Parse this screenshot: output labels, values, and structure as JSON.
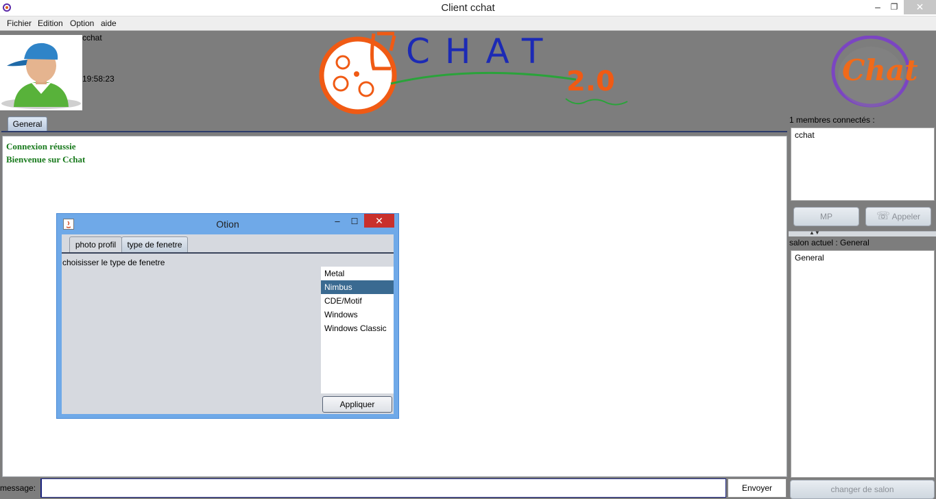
{
  "window": {
    "title": "Client cchat",
    "min_glyph": "–",
    "restore_glyph": "❐",
    "close_glyph": "✕"
  },
  "menu": [
    "Fichier",
    "Edition",
    "Option",
    "aide"
  ],
  "header": {
    "username": "cchat",
    "clock": "19:58:23",
    "logo_text": "CHAT",
    "logo_version": "2.0",
    "brand_text": "Chat"
  },
  "tabs": [
    {
      "label": "General"
    }
  ],
  "chat": {
    "messages": [
      "Connexion réussie",
      "Bienvenue sur Cchat"
    ]
  },
  "members": {
    "label": "1 membres connectés :",
    "list": [
      "cchat"
    ]
  },
  "buttons": {
    "mp": "MP",
    "call": "Appeler",
    "send": "Envoyer",
    "change_salon": "changer de salon"
  },
  "salon": {
    "label": "salon actuel : General",
    "list": [
      "General"
    ]
  },
  "message": {
    "label": "message:",
    "value": ""
  },
  "dialog": {
    "title": "Otion",
    "tabs": [
      "photo profil",
      "type de fenetre"
    ],
    "prompt": "choisisser le type de fenetre",
    "options": [
      "Metal",
      "Nimbus",
      "CDE/Motif",
      "Windows",
      "Windows Classic"
    ],
    "selected": "Nimbus",
    "apply": "Appliquer"
  },
  "colors": {
    "background": "#7d7d7d",
    "chat_text": "#17791b",
    "selection": "#3a6a91",
    "dialog_frame": "#6fa9e8",
    "close_red": "#c9302c"
  }
}
